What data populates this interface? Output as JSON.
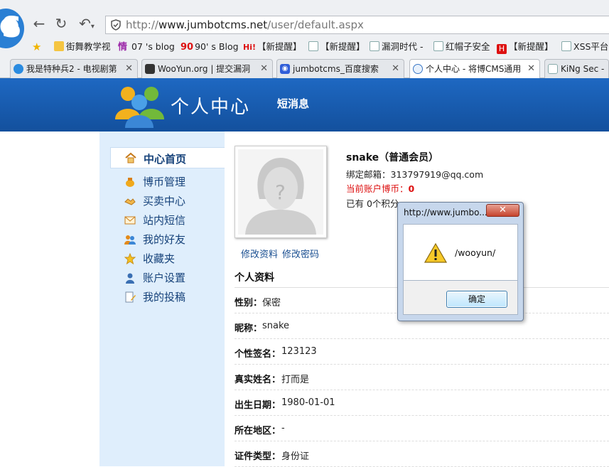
{
  "browser": {
    "url_prefix": "http://",
    "url_host": "www.jumbotcms.net",
    "url_path": "/user/default.aspx"
  },
  "bookmarks": [
    {
      "label": "街舞教学视",
      "icon": "folder-icon"
    },
    {
      "label": "07 's blog",
      "prefix": "情",
      "icon": "blog-icon"
    },
    {
      "label": "90' s Blog",
      "prefix": "90",
      "icon": "blog-icon"
    },
    {
      "label": "【新提醒】",
      "prefix": "Hi!",
      "icon": "hi-icon"
    },
    {
      "label": "【新提醒】",
      "icon": "page-icon"
    },
    {
      "label": "漏洞时代 -",
      "icon": "page-icon"
    },
    {
      "label": "红帽子安全",
      "icon": "page-icon"
    },
    {
      "label": "【新提醒】",
      "prefix": "H",
      "icon": "h-icon"
    },
    {
      "label": "XSS平台-",
      "icon": "page-icon"
    }
  ],
  "tabs": [
    {
      "label": "我是特种兵2 - 电视剧第",
      "icon": "shield-icon"
    },
    {
      "label": "WooYun.org | 提交漏洞",
      "icon": "wooyun-icon"
    },
    {
      "label": "jumbotcms_百度搜索",
      "icon": "baidu-paw-icon"
    },
    {
      "label": "个人中心 - 将博CMS通用",
      "icon": "ie-page-icon",
      "active": true
    },
    {
      "label": "KiNg Sec -",
      "icon": "page-icon"
    }
  ],
  "header": {
    "title": "个人中心",
    "nav_message": "短消息"
  },
  "sidebar": {
    "home": "中心首页",
    "items": [
      {
        "label": "博币管理",
        "icon": "coin-bag-icon"
      },
      {
        "label": "买卖中心",
        "icon": "handshake-icon"
      },
      {
        "label": "站内短信",
        "icon": "envelope-icon"
      },
      {
        "label": "我的好友",
        "icon": "friends-icon"
      },
      {
        "label": "收藏夹",
        "icon": "star-icon"
      },
      {
        "label": "账户设置",
        "icon": "user-settings-icon"
      },
      {
        "label": "我的投稿",
        "icon": "document-edit-icon"
      }
    ]
  },
  "user": {
    "name": "snake（普通会员）",
    "email_label": "绑定邮箱：",
    "email": "313797919@qq.com",
    "coins_label": "当前账户博币：",
    "coins": "0",
    "points": "已有 0个积分",
    "edit_profile": "修改资料",
    "edit_password": "修改密码"
  },
  "profile": {
    "title": "个人资料",
    "rows": [
      {
        "key": "性别：",
        "value": "保密"
      },
      {
        "key": "昵称：",
        "value": "snake"
      },
      {
        "key": "个性签名：",
        "value": "123123"
      },
      {
        "key": "真实姓名：",
        "value": "打而是"
      },
      {
        "key": "出生日期：",
        "value": "1980-01-01"
      },
      {
        "key": "所在地区：",
        "value": "-"
      },
      {
        "key": "证件类型：",
        "value": "身份证"
      }
    ]
  },
  "alert": {
    "title": "http://www.jumbo...",
    "message": "/wooyun/",
    "ok_label": "确定",
    "close_label": "✕"
  },
  "colors": {
    "header_blue": "#1a5fb4",
    "sidebar_bg": "#dfeefc",
    "coin_red": "#dd1111"
  }
}
